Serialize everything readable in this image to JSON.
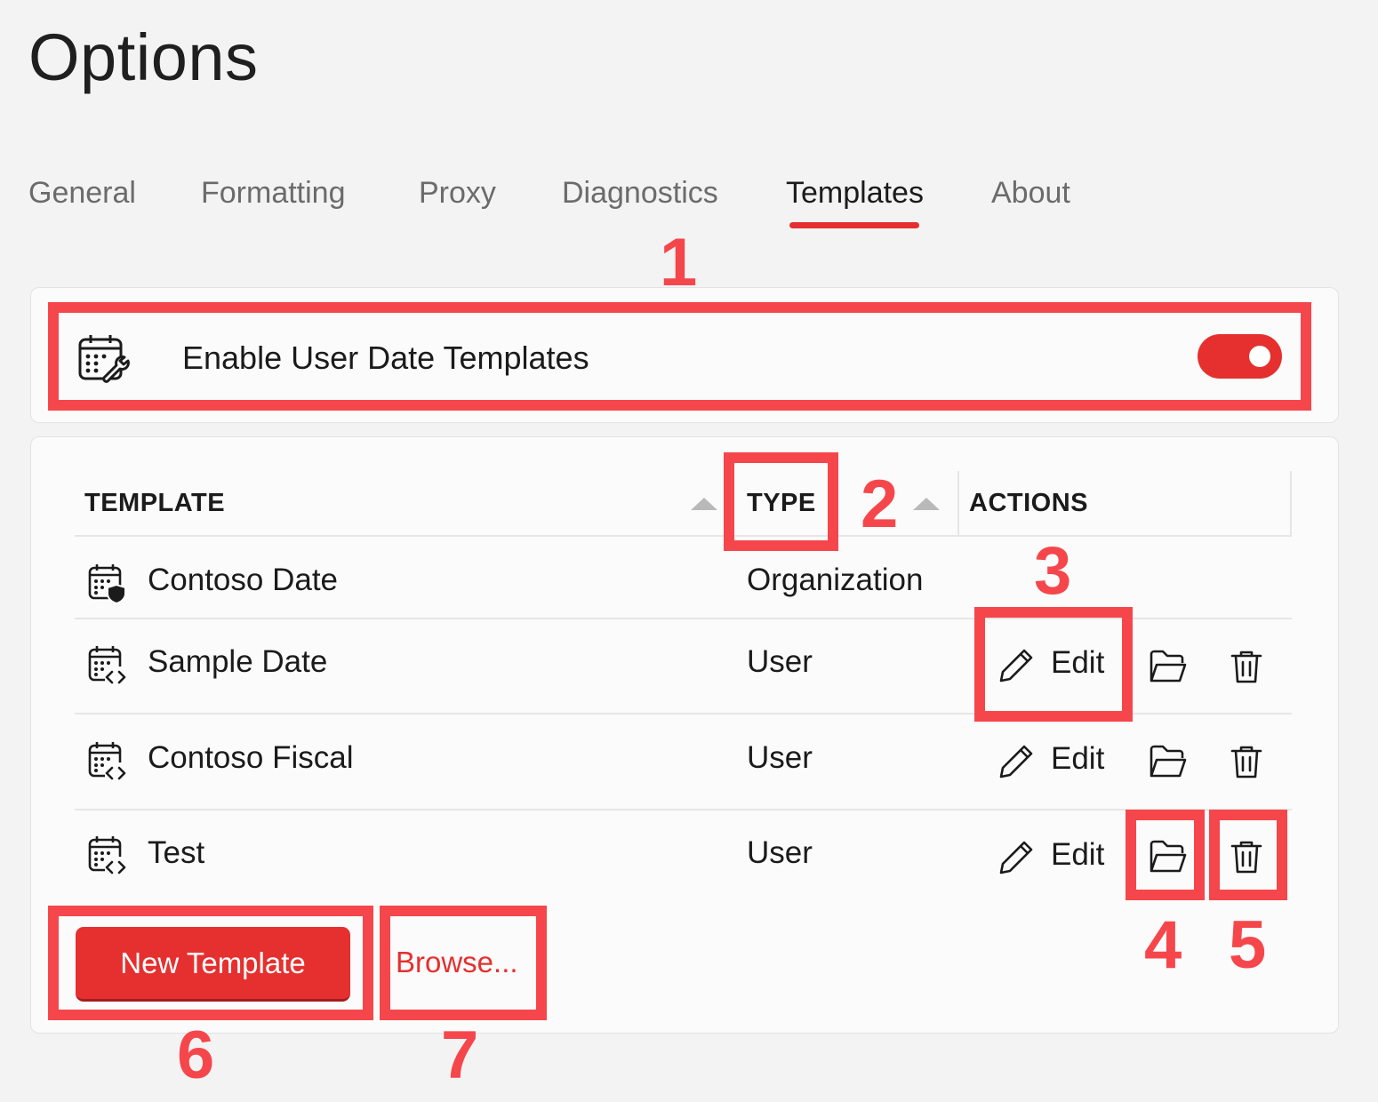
{
  "page": {
    "title": "Options"
  },
  "tabs": [
    {
      "label": "General"
    },
    {
      "label": "Formatting"
    },
    {
      "label": "Proxy"
    },
    {
      "label": "Diagnostics"
    },
    {
      "label": "Templates",
      "active": true
    },
    {
      "label": "About"
    }
  ],
  "setting": {
    "label": "Enable User Date Templates",
    "icon": "calendar-wrench-icon",
    "enabled": true
  },
  "table": {
    "headers": {
      "template": "TEMPLATE",
      "type": "TYPE",
      "actions": "ACTIONS"
    },
    "rows": [
      {
        "name": "Contoso Date",
        "type": "Organization",
        "icon": "calendar-shield-icon",
        "edit": ""
      },
      {
        "name": "Sample Date",
        "type": "User",
        "icon": "calendar-code-icon",
        "edit": "Edit"
      },
      {
        "name": "Contoso Fiscal",
        "type": "User",
        "icon": "calendar-code-icon",
        "edit": "Edit"
      },
      {
        "name": "Test",
        "type": "User",
        "icon": "calendar-code-icon",
        "edit": "Edit"
      }
    ]
  },
  "buttons": {
    "new_template": "New Template",
    "browse": "Browse..."
  },
  "annotations": [
    "1",
    "2",
    "3",
    "4",
    "5",
    "6",
    "7"
  ],
  "colors": {
    "accent": "#e5302f",
    "callout": "#f5474b",
    "background": "#f3f3f3"
  }
}
